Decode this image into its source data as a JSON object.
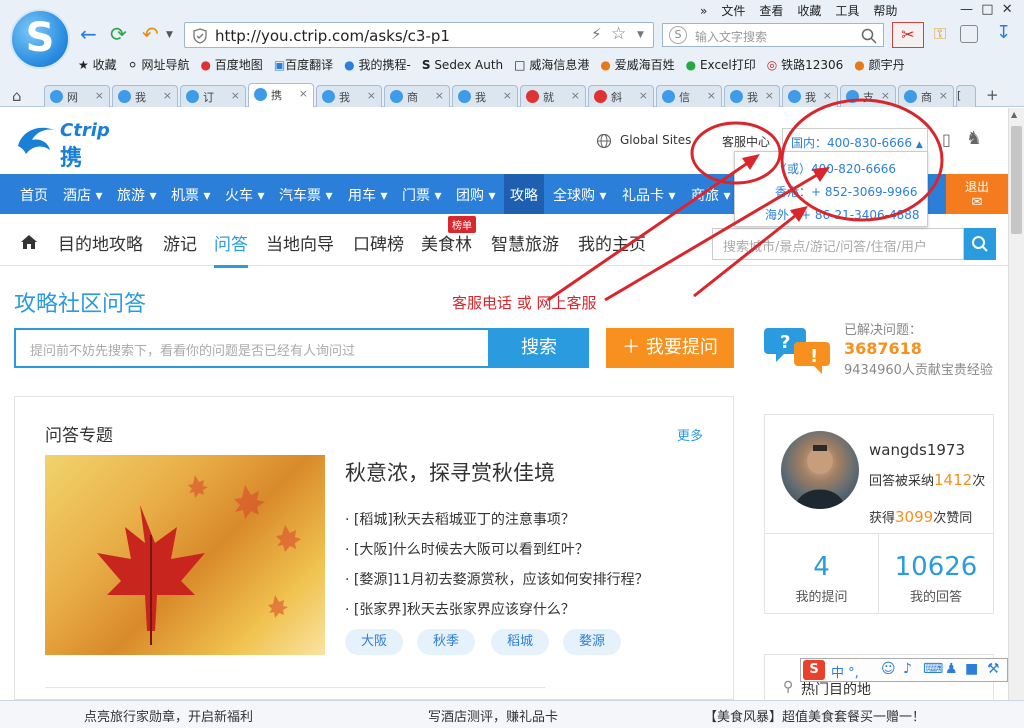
{
  "browser": {
    "url": "http://you.ctrip.com/asks/c3-p1",
    "menu": [
      "»",
      "文件",
      "查看",
      "收藏",
      "工具",
      "帮助"
    ],
    "search_placeholder": "输入文字搜索",
    "bookmarks": [
      "收藏",
      "网址导航",
      "百度地图",
      "百度翻译",
      "我的携程-",
      "Sedex Auth",
      "威海信息港",
      "爱威海百姓",
      "Excel打印",
      "铁路12306",
      "颜宇丹"
    ],
    "tabs": [
      "网",
      "我",
      "订",
      "携",
      "我",
      "商",
      "我",
      "就",
      "斜",
      "信",
      "我",
      "我",
      "支",
      "商",
      "["
    ]
  },
  "header": {
    "global_sites": "Global Sites",
    "service_center": "客服中心",
    "domestic_phone": "国内：400-830-6666",
    "dropdown": [
      "（或）400-820-6666",
      "香港：+ 852-3069-9966",
      "海外：+ 86-21-3406-4888"
    ],
    "logo_en": "Ctrip",
    "logo_cn": "携程"
  },
  "main_nav": {
    "items": [
      "首页",
      "酒店 ▾",
      "旅游 ▾",
      "机票 ▾",
      "火车 ▾",
      "汽车票 ▾",
      "用车 ▾",
      "门票 ▾",
      "团购 ▾",
      "攻略",
      "全球购 ▾",
      "礼品卡 ▾",
      "商旅 ▾"
    ],
    "exit": "退出"
  },
  "sub_nav": {
    "items": [
      "目的地攻略",
      "游记",
      "问答",
      "当地向导",
      "口碑榜",
      "美食林",
      "智慧旅游",
      "我的主页"
    ],
    "badge": "榜单",
    "search_placeholder": "搜索城市/景点/游记/问答/住宿/用户"
  },
  "page": {
    "title": "攻略社区问答",
    "annotation": "客服电话 或 网上客服",
    "ask_placeholder": "提问前不妨先搜索下，看看你的问题是否已经有人询问过",
    "search_button": "搜索",
    "ask_button": "＋ 我要提问"
  },
  "topics": {
    "header": "问答专题",
    "more": "更多",
    "title": "秋意浓，探寻赏秋佳境",
    "questions": [
      "· [稻城]秋天去稻城亚丁的注意事项？",
      "· [大阪]什么时候去大阪可以看到红叶？",
      "· [婺源]11月初去婺源赏秋，应该如何安排行程？",
      "· [张家界]秋天去张家界应该穿什么？"
    ],
    "tags": [
      "大阪",
      "秋季",
      "稻城",
      "婺源"
    ]
  },
  "stats": {
    "solved_label": "已解决问题：",
    "solved": "3687618",
    "contrib": "9434960人贡献宝贵经验"
  },
  "user": {
    "name": "wangds1973",
    "adopted_prefix": "回答被采纳",
    "adopted": "1412",
    "adopted_suffix": "次",
    "praise_prefix": "获得",
    "praise": "3099",
    "praise_suffix": "次赞同",
    "questions": "4",
    "questions_label": "我的提问",
    "answers": "10626",
    "answers_label": "我的回答"
  },
  "hot": {
    "label": "热门目的地"
  },
  "ime": {
    "label": "中 °,"
  },
  "bottom": [
    "点亮旅行家勋章，开启新福利",
    "写酒店测评，赚礼品卡",
    "【美食风暴】超值美食套餐买一赠一！"
  ],
  "colors": {
    "brand_blue": "#2b7fd9",
    "accent_orange": "#f7901e",
    "annotation_red": "#d8262c"
  }
}
